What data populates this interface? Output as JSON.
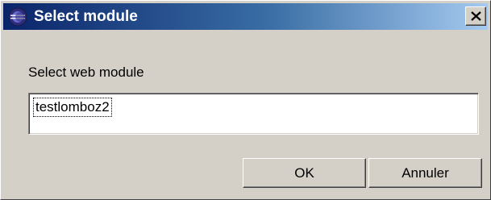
{
  "window": {
    "title": "Select module",
    "app_icon": "eclipse-icon",
    "close_icon": "close-icon",
    "titlebar_colors": [
      "#0a246a",
      "#a6caf0"
    ]
  },
  "content": {
    "prompt_label": "Select web module",
    "selected_module": "testlomboz2"
  },
  "buttons": {
    "ok_label": "OK",
    "cancel_label": "Annuler"
  }
}
